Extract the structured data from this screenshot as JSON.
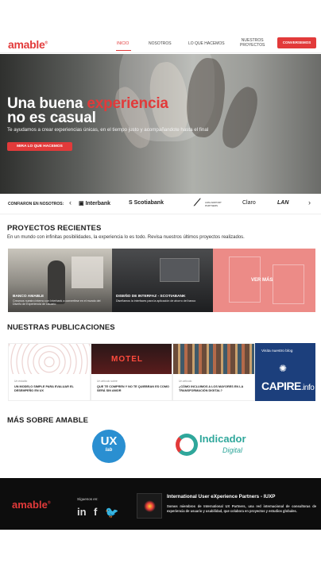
{
  "brand": {
    "name": "amable",
    "mark": "®",
    "accent": "#e23a3a"
  },
  "nav": {
    "items": [
      {
        "label": "INICIO",
        "active": true
      },
      {
        "label": "NOSOTROS",
        "active": false
      },
      {
        "label": "LO QUE HACEMOS",
        "active": false
      },
      {
        "label": "NUESTROS",
        "label2": "PROYECTOS",
        "active": false
      }
    ],
    "cta": "CONVERSEMOS"
  },
  "hero": {
    "title_line1_a": "Una buena ",
    "title_line1_b": "experiencia",
    "title_line2": "no es casual",
    "subtitle": "Te ayudamos a crear experiencias únicas, en el tiempo justo y acompañandote hasta el final",
    "button": "MIRA LO QUE HACEMOS"
  },
  "clients": {
    "label": "CONFIARON EN NOSOTROS:",
    "prev_icon": "chevron-left-icon",
    "next_icon": "chevron-right-icon",
    "logos": [
      "Interbank",
      "Scotiabank",
      "LIMA AIRPORT PARTNERS",
      "Claro",
      "LAN"
    ]
  },
  "projects": {
    "title": "PROYECTOS RECIENTES",
    "subtitle": "En un mundo con infinitas posibilidades, la experiencia lo es todo. Revisa  nuestros últimos proyectos realizados.",
    "items": [
      {
        "title": "BANCO AMABLE",
        "desc": "Creamos nuestro interno con Interbank a convertirse en el mundo del Diseño de Experiencia de Usuario"
      },
      {
        "title": "DISEÑO DE INTERFAZ - SCOTIABANK",
        "desc": "Diseñamos la interfaces para la aplicación de ahorro del banco"
      }
    ],
    "more": "VER MÁS"
  },
  "publications": {
    "title": "NUESTRAS PUBLICACIONES",
    "items": [
      {
        "category": "Un estudio",
        "title": "UN MODELO SIMPLE PARA EVALUAR EL DESEMPEÑO EN UX"
      },
      {
        "category": "Un artículo sobre",
        "title": "QUE TE COMPREN Y NO TE QUIEBRAN ES COMO SERÁ SIN AMOR"
      },
      {
        "category": "Un artículo",
        "title": "¿CÓMO INCLUIMOS A LOS MAYORES EN LA TRANSFORMACIÓN DIGITAL?"
      }
    ],
    "blog_label": "Visita nuestro blog",
    "blog_name": "CAPIRE",
    "blog_tld": ".info"
  },
  "more_about": {
    "title": "MÁS SOBRE AMABLE",
    "uxlab_big": "UX",
    "uxlab_small": "lab",
    "indicador": "Indicador",
    "indicador_sub": "Digital"
  },
  "footer": {
    "follow": "Síguenos en:",
    "social": [
      "in",
      "f",
      "twitter"
    ],
    "partner_title": "International User eXperience Partners - IUXP",
    "partner_desc": "Somos miembros de International UX Partners, una red internacional de consultoras de experiencia de usuario y usabilidad, que colabora en proyectos y estudios globales."
  }
}
